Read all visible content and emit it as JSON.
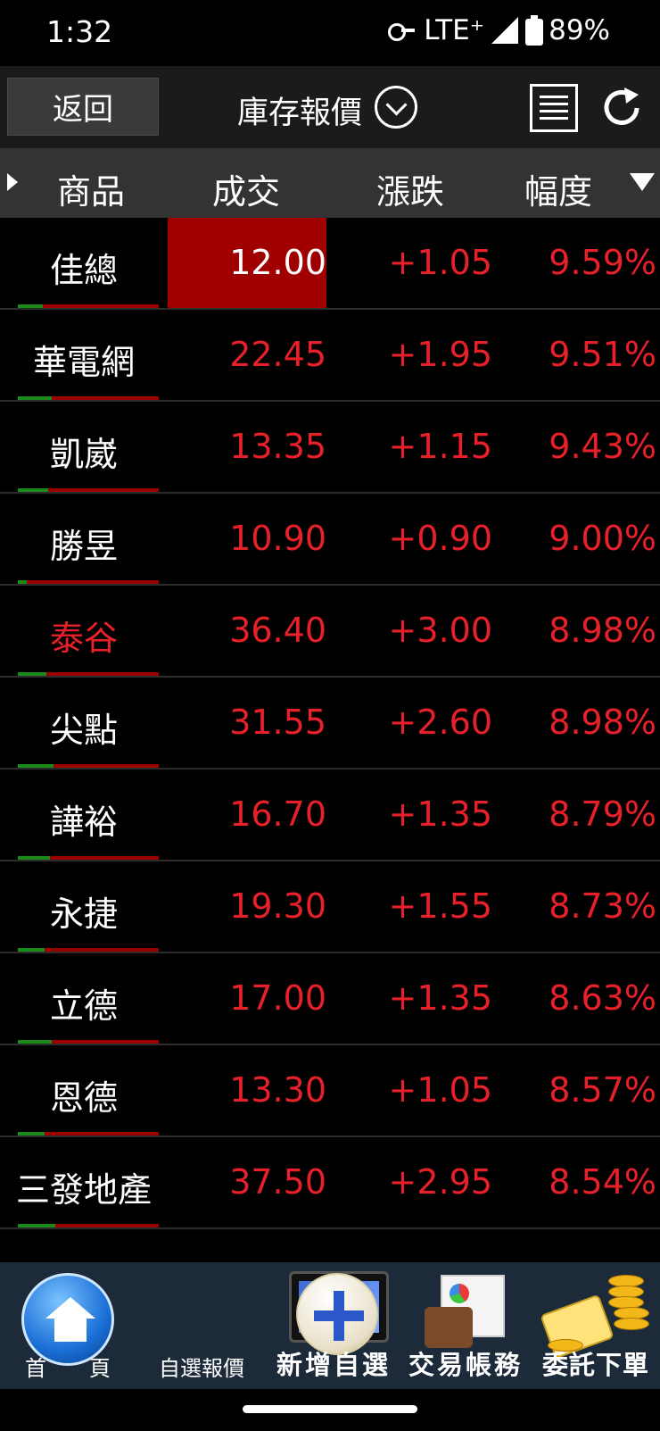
{
  "status": {
    "time": "1:32",
    "network": "LTE⁺",
    "battery": "89%"
  },
  "header": {
    "back_label": "返回",
    "title": "庫存報價"
  },
  "columns": {
    "name": "商品",
    "price": "成交",
    "change": "漲跌",
    "pct": "幅度"
  },
  "rows": [
    {
      "name": "佳總",
      "price": "12.00",
      "change": "+1.05",
      "pct": "9.59%"
    },
    {
      "name": "華電網",
      "price": "22.45",
      "change": "+1.95",
      "pct": "9.51%"
    },
    {
      "name": "凱崴",
      "price": "13.35",
      "change": "+1.15",
      "pct": "9.43%"
    },
    {
      "name": "勝昱",
      "price": "10.90",
      "change": "+0.90",
      "pct": "9.00%"
    },
    {
      "name": "泰谷",
      "price": "36.40",
      "change": "+3.00",
      "pct": "8.98%"
    },
    {
      "name": "尖點",
      "price": "31.55",
      "change": "+2.60",
      "pct": "8.98%"
    },
    {
      "name": "譁裕",
      "price": "16.70",
      "change": "+1.35",
      "pct": "8.79%"
    },
    {
      "name": "永捷",
      "price": "19.30",
      "change": "+1.55",
      "pct": "8.73%"
    },
    {
      "name": "立德",
      "price": "17.00",
      "change": "+1.35",
      "pct": "8.63%"
    },
    {
      "name": "恩德",
      "price": "13.30",
      "change": "+1.05",
      "pct": "8.57%"
    },
    {
      "name": "三發地產",
      "price": "37.50",
      "change": "+2.95",
      "pct": "8.54%"
    }
  ],
  "nav": {
    "home": "首　　頁",
    "watchlist": "自選報價",
    "add_watch": "新增自選",
    "account": "交易帳務",
    "order": "委託下單"
  },
  "colors": {
    "up_red": "#e8202a",
    "flash_bg": "#a00000",
    "header_bg": "#333333"
  }
}
